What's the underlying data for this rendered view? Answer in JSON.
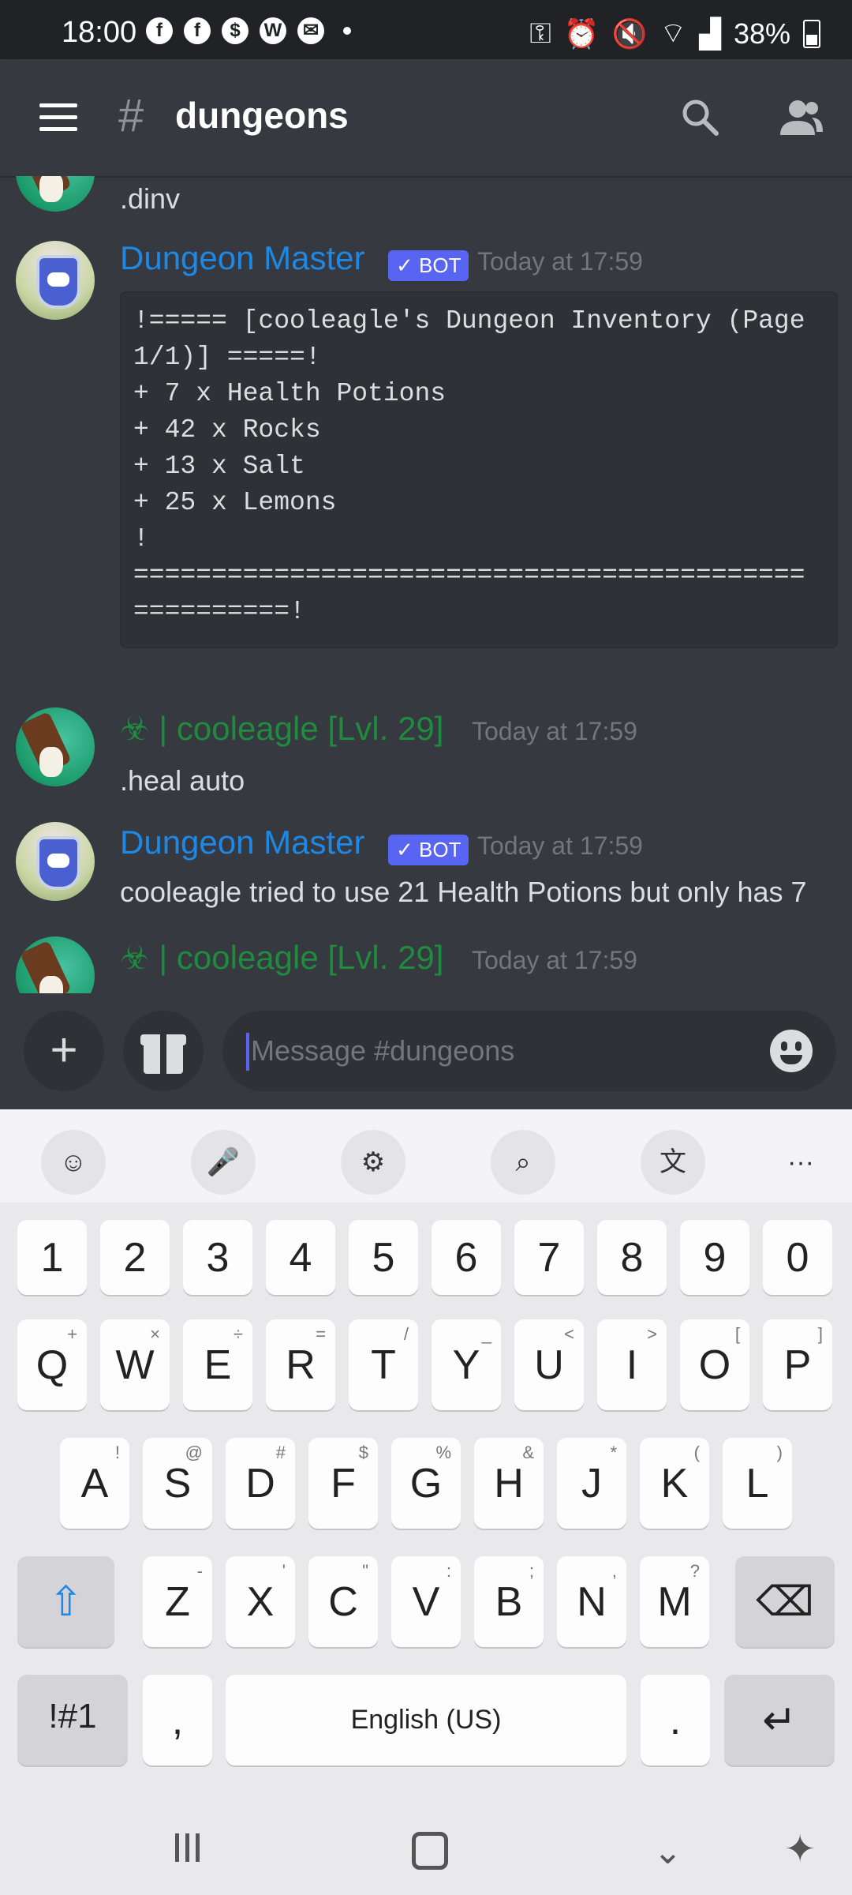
{
  "status_bar": {
    "time": "18:00",
    "battery": "38%",
    "left_icons": [
      "facebook-icon",
      "facebook-icon",
      "dollar-icon",
      "wsop-icon",
      "mail-icon"
    ],
    "right_icons": [
      "key-icon",
      "alarm-icon",
      "mute-icon",
      "wifi-icon",
      "signal-icon",
      "battery-icon"
    ]
  },
  "header": {
    "hash": "#",
    "channel": "dungeons"
  },
  "messages": [
    {
      "type": "continued",
      "text": ".dinv"
    },
    {
      "type": "bot",
      "author": "Dungeon Master",
      "badge": "✓ BOT",
      "time": "Today at 17:59",
      "code": "!===== [cooleagle's Dungeon Inventory (Page\n1/1)] =====!\n+ 7 x Health Potions\n+ 42 x Rocks\n+ 13 x Salt\n+ 25 x Lemons\n!\n===========================================\n==========!"
    },
    {
      "type": "user",
      "author": "☣ | cooleagle [Lvl. 29]",
      "time": "Today at 17:59",
      "text": ".heal auto"
    },
    {
      "type": "bot",
      "author": "Dungeon Master",
      "badge": "✓ BOT",
      "time": "Today at 17:59",
      "text": "cooleagle tried to use 21 Health Potions but only has 7"
    },
    {
      "type": "user",
      "author": "☣ | cooleagle [Lvl. 29]",
      "time": "Today at 17:59"
    }
  ],
  "input": {
    "placeholder": "Message #dungeons"
  },
  "keyboard": {
    "toolbar": [
      "emoji-icon",
      "mic-icon",
      "settings-icon",
      "search-icon",
      "translate-icon",
      "more-icon"
    ],
    "more_glyph": "···",
    "row_numbers": [
      "1",
      "2",
      "3",
      "4",
      "5",
      "6",
      "7",
      "8",
      "9",
      "0"
    ],
    "row1": [
      {
        "k": "Q",
        "s": "+"
      },
      {
        "k": "W",
        "s": "×"
      },
      {
        "k": "E",
        "s": "÷"
      },
      {
        "k": "R",
        "s": "="
      },
      {
        "k": "T",
        "s": "/"
      },
      {
        "k": "Y",
        "s": "_"
      },
      {
        "k": "U",
        "s": "<"
      },
      {
        "k": "I",
        "s": ">"
      },
      {
        "k": "O",
        "s": "["
      },
      {
        "k": "P",
        "s": "]"
      }
    ],
    "row2": [
      {
        "k": "A",
        "s": "!"
      },
      {
        "k": "S",
        "s": "@"
      },
      {
        "k": "D",
        "s": "#"
      },
      {
        "k": "F",
        "s": "$"
      },
      {
        "k": "G",
        "s": "%"
      },
      {
        "k": "H",
        "s": "&"
      },
      {
        "k": "J",
        "s": "*"
      },
      {
        "k": "K",
        "s": "("
      },
      {
        "k": "L",
        "s": ")"
      }
    ],
    "row3": [
      {
        "k": "Z",
        "s": "-"
      },
      {
        "k": "X",
        "s": "'"
      },
      {
        "k": "C",
        "s": "\""
      },
      {
        "k": "V",
        "s": ":"
      },
      {
        "k": "B",
        "s": ";"
      },
      {
        "k": "N",
        "s": ","
      },
      {
        "k": "M",
        "s": "?"
      }
    ],
    "symbols_label": "!#1",
    "comma": ",",
    "space_label": "English (US)",
    "period": "."
  }
}
